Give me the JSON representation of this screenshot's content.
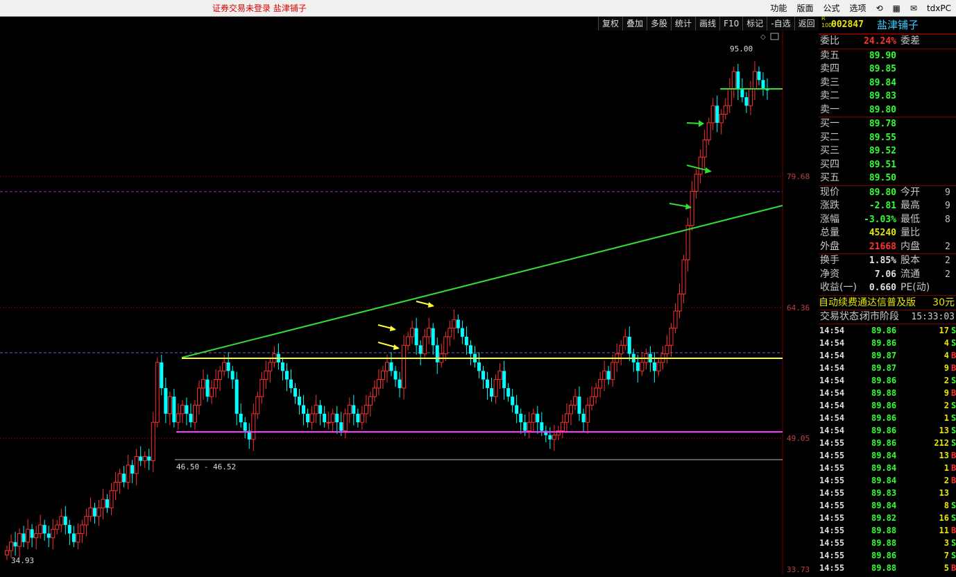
{
  "window": {
    "status_text": "证券交易未登录  盐津铺子",
    "menu": [
      "功能",
      "版面",
      "公式",
      "选项",
      "tdxPC"
    ]
  },
  "toolbar": [
    "复权",
    "叠加",
    "多股",
    "统计",
    "画线",
    "F10",
    "标记",
    "-自选",
    "返回"
  ],
  "stock": {
    "code": "002847",
    "name": "盐津铺子",
    "badge_r": "R",
    "badge_n": "1000"
  },
  "order_ratio": {
    "label": "委比",
    "value": "24.24%",
    "label2": "委差"
  },
  "asks": [
    {
      "label": "卖五",
      "price": "89.90"
    },
    {
      "label": "卖四",
      "price": "89.85"
    },
    {
      "label": "卖三",
      "price": "89.84"
    },
    {
      "label": "卖二",
      "price": "89.83"
    },
    {
      "label": "卖一",
      "price": "89.80"
    }
  ],
  "bids": [
    {
      "label": "买一",
      "price": "89.78"
    },
    {
      "label": "买二",
      "price": "89.55"
    },
    {
      "label": "买三",
      "price": "89.52"
    },
    {
      "label": "买四",
      "price": "89.51"
    },
    {
      "label": "买五",
      "price": "89.50"
    }
  ],
  "quote": [
    {
      "label": "现价",
      "value": "89.80",
      "label2": "今开",
      "value2": "9"
    },
    {
      "label": "涨跌",
      "value": "-2.81",
      "label2": "最高",
      "value2": "9"
    },
    {
      "label": "涨幅",
      "value": "-3.03%",
      "label2": "最低",
      "value2": "8"
    },
    {
      "label": "总量",
      "value": "45240",
      "label2": "量比",
      "value2": ""
    },
    {
      "label": "外盘",
      "value": "21668",
      "label2": "内盘",
      "value2": "2"
    }
  ],
  "fundamentals": [
    {
      "label": "换手",
      "value": "1.85%",
      "label2": "股本",
      "value2": "2"
    },
    {
      "label": "净资",
      "value": "7.06",
      "label2": "流通",
      "value2": "2"
    },
    {
      "label": "收益(一)",
      "value": "0.660",
      "label2": "PE(动)",
      "value2": ""
    }
  ],
  "promo": {
    "text": "自动续费通达信普及版",
    "price": "30元"
  },
  "trade_state": {
    "label": "交易状态:",
    "value": "闭市阶段",
    "time": "15:33:03"
  },
  "ticks": [
    {
      "t": "14:54",
      "p": "89.86",
      "v": "17",
      "bs": "S"
    },
    {
      "t": "14:54",
      "p": "89.86",
      "v": "4",
      "bs": "S"
    },
    {
      "t": "14:54",
      "p": "89.87",
      "v": "4",
      "bs": "B"
    },
    {
      "t": "14:54",
      "p": "89.87",
      "v": "9",
      "bs": "B"
    },
    {
      "t": "14:54",
      "p": "89.86",
      "v": "2",
      "bs": "S"
    },
    {
      "t": "14:54",
      "p": "89.88",
      "v": "9",
      "bs": "B"
    },
    {
      "t": "14:54",
      "p": "89.86",
      "v": "2",
      "bs": "S"
    },
    {
      "t": "14:54",
      "p": "89.86",
      "v": "1",
      "bs": "S"
    },
    {
      "t": "14:54",
      "p": "89.86",
      "v": "13",
      "bs": "S"
    },
    {
      "t": "14:55",
      "p": "89.86",
      "v": "212",
      "bs": "S"
    },
    {
      "t": "14:55",
      "p": "89.84",
      "v": "13",
      "bs": "B"
    },
    {
      "t": "14:55",
      "p": "89.84",
      "v": "1",
      "bs": "B"
    },
    {
      "t": "14:55",
      "p": "89.84",
      "v": "2",
      "bs": "B"
    },
    {
      "t": "14:55",
      "p": "89.83",
      "v": "13",
      "bs": ""
    },
    {
      "t": "14:55",
      "p": "89.84",
      "v": "8",
      "bs": "S"
    },
    {
      "t": "14:55",
      "p": "89.82",
      "v": "16",
      "bs": "S"
    },
    {
      "t": "14:55",
      "p": "89.88",
      "v": "11",
      "bs": "B"
    },
    {
      "t": "14:55",
      "p": "89.88",
      "v": "3",
      "bs": "S"
    },
    {
      "t": "14:55",
      "p": "89.86",
      "v": "7",
      "bs": "S"
    },
    {
      "t": "14:55",
      "p": "89.88",
      "v": "5",
      "bs": "B"
    }
  ],
  "colors": {
    "up": "#ff3030",
    "down": "#00ffff",
    "trend": "#33dd33",
    "support": "#ff33ff",
    "resistance": "#ffff33"
  },
  "chart_data": {
    "type": "candlestick",
    "y_axis_labels": [
      "79.68",
      "64.36",
      "49.05",
      "33.73"
    ],
    "annotations": {
      "high_label": "95.00",
      "low_label": "34.93",
      "range_label": "46.50 - 46.52"
    },
    "closes": [
      36,
      37,
      36.5,
      38,
      37,
      38.5,
      37.5,
      38,
      39,
      38,
      37.5,
      38.5,
      39,
      40,
      39,
      38,
      37,
      38,
      39,
      40,
      41,
      40,
      41,
      42,
      41,
      43,
      44,
      45,
      44,
      46,
      45,
      47,
      46.5,
      47,
      46.52,
      51,
      58,
      55,
      52,
      54,
      51,
      52,
      53,
      52,
      51,
      53,
      55,
      56,
      54,
      55,
      56,
      57,
      58,
      57,
      56,
      52,
      51,
      50,
      49,
      52,
      54,
      56,
      57,
      58,
      59,
      58,
      57,
      56,
      55,
      54,
      53,
      52,
      51,
      52,
      53,
      52,
      51,
      51,
      52,
      51,
      50,
      52,
      53,
      52,
      51,
      52,
      53,
      54,
      55,
      56,
      57,
      58,
      57,
      56,
      55,
      60,
      61,
      62,
      60,
      59,
      61,
      62,
      60,
      58,
      59,
      61,
      62,
      63,
      62,
      61,
      60,
      59,
      58,
      57,
      56,
      55,
      54,
      56,
      57,
      55,
      54,
      53,
      52,
      51,
      50,
      51,
      52,
      51,
      50,
      49.5,
      49,
      49.5,
      50,
      51,
      52,
      53,
      54,
      52,
      51,
      53,
      54,
      55,
      56,
      57,
      56,
      58,
      59,
      60,
      61,
      59,
      58,
      57,
      58,
      59,
      58,
      57,
      58,
      59,
      60,
      62,
      64,
      66,
      70,
      74,
      78,
      80,
      82,
      84,
      86,
      88,
      86,
      87,
      88,
      90,
      92,
      90,
      89,
      88,
      90,
      92,
      91,
      90,
      89.8
    ],
    "trendlines": [
      {
        "name": "rising-trend",
        "from": [
          0.1,
          57.0
        ],
        "to": [
          1.0,
          78.2
        ]
      },
      {
        "name": "resistance",
        "value": 56.6
      },
      {
        "name": "support",
        "value": 49.9
      },
      {
        "name": "top",
        "value": 88.5
      }
    ]
  }
}
